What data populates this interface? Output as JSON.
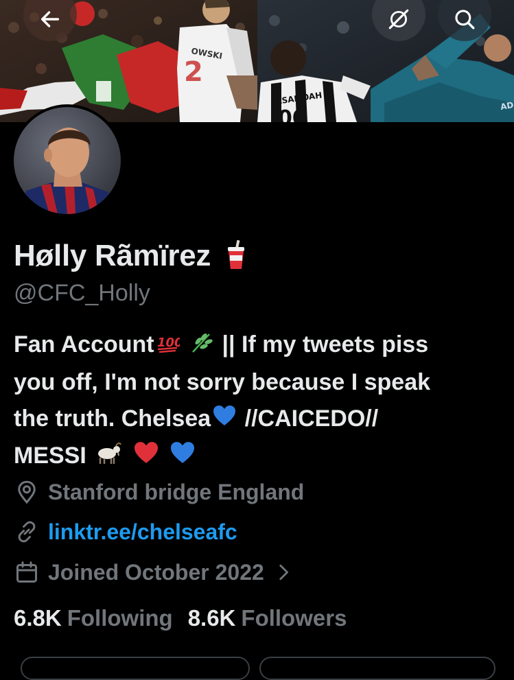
{
  "header": {
    "back_icon": "arrow-left-icon",
    "grok_icon": "grok-icon",
    "search_icon": "search-icon"
  },
  "profile": {
    "display_name": "Høllу Rãmïrez",
    "name_emoji": "cup-with-straw-emoji",
    "handle": "@CFC_Holly",
    "bio": {
      "line1_a": "Fan Account",
      "line1_b": "|| If my tweets piss",
      "line2": "you off, I'm not sorry because I speak",
      "line3_a": "the truth. Chelsea",
      "line3_b": "//CAICEDO//",
      "line4": "MESSI"
    },
    "location": "Stanford bridge England",
    "link": "linktr.ee/chelseafc",
    "joined": "Joined October 2022",
    "following_count": "6.8K",
    "following_label": "Following",
    "followers_count": "8.6K",
    "followers_label": "Followers"
  },
  "colors": {
    "background": "#000000",
    "text_primary": "#e7e9ea",
    "text_secondary": "#71767b",
    "link": "#1d9bf0"
  }
}
